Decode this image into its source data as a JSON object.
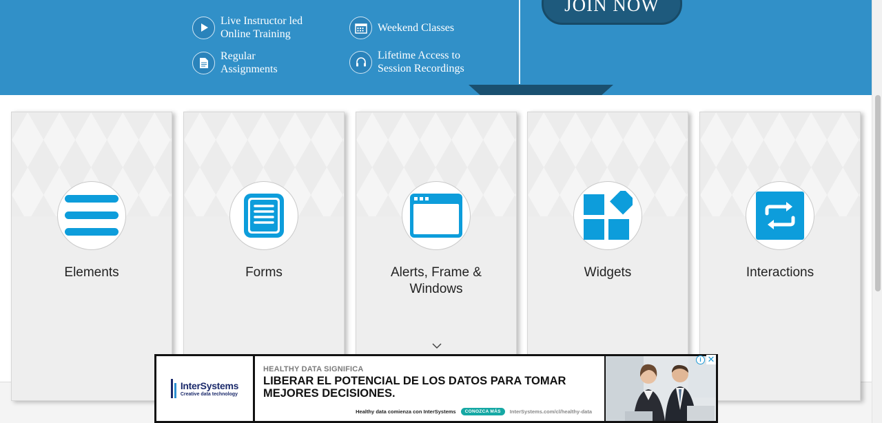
{
  "banner": {
    "features": [
      {
        "text": "Live Instructor led\nOnline Training",
        "icon": "play-icon"
      },
      {
        "text": "Weekend Classes",
        "icon": "calendar-icon"
      },
      {
        "text": "Regular\nAssignments",
        "icon": "document-icon"
      },
      {
        "text": "Lifetime Access to\nSession Recordings",
        "icon": "headphones-icon"
      }
    ],
    "join_label": "JOIN NOW"
  },
  "cards": [
    {
      "title": "Elements",
      "icon": "menu-lines-icon"
    },
    {
      "title": "Forms",
      "icon": "form-document-icon"
    },
    {
      "title": "Alerts, Frame &\nWindows",
      "icon": "browser-window-icon"
    },
    {
      "title": "Widgets",
      "icon": "widgets-icon"
    },
    {
      "title": "Interactions",
      "icon": "interactions-arrows-icon"
    }
  ],
  "colors": {
    "banner": "#3190c8",
    "accent": "#0d9ddb",
    "button": "#1e5a7d"
  },
  "ad": {
    "brand": "InterSystems",
    "tagline": "Creative data technology",
    "kicker": "HEALTHY DATA SIGNIFICA",
    "headline": "LIBERAR EL POTENCIAL DE LOS DATOS PARA TOMAR MEJORES DECISIONES.",
    "footer_text": "Healthy data comienza con InterSystems",
    "cta": "CONOZCA MÁS",
    "url": "InterSystems.com/cl/healthy-data",
    "info_symbol": "i",
    "close_symbol": "✕"
  }
}
